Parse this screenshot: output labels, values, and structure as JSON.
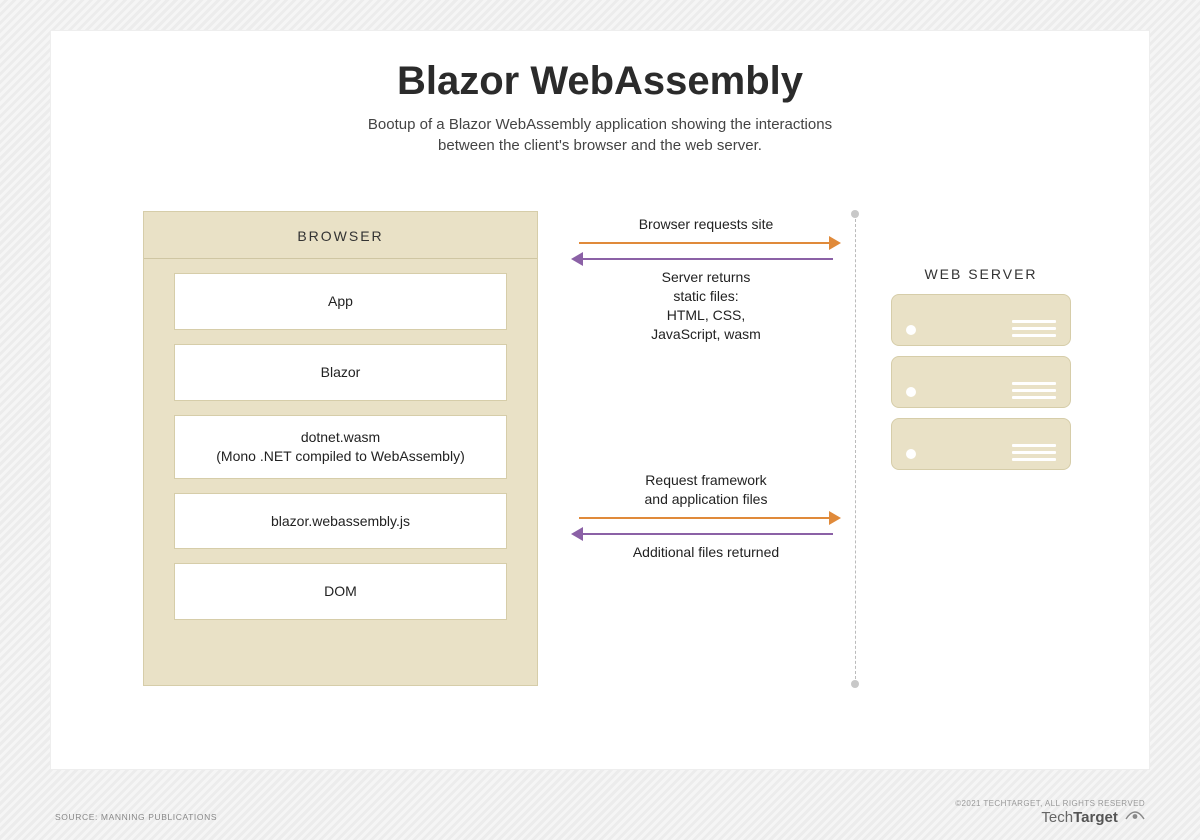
{
  "title": "Blazor WebAssembly",
  "subtitle_l1": "Bootup of a Blazor WebAssembly application showing the interactions",
  "subtitle_l2": "between the client's browser and the web server.",
  "browser": {
    "header": "BROWSER",
    "layers": {
      "app": "App",
      "blazor": "Blazor",
      "dotnet_l1": "dotnet.wasm",
      "dotnet_l2": "(Mono .NET compiled to WebAssembly)",
      "js": "blazor.webassembly.js",
      "dom": "DOM"
    }
  },
  "interactions": {
    "top_request": "Browser requests site",
    "top_response_l1": "Server returns",
    "top_response_l2": "static files:",
    "top_response_l3": "HTML, CSS,",
    "top_response_l4": "JavaScript, wasm",
    "bottom_request_l1": "Request framework",
    "bottom_request_l2": "and application files",
    "bottom_response": "Additional files returned"
  },
  "server_label": "WEB SERVER",
  "footer": {
    "source": "SOURCE: MANNING PUBLICATIONS",
    "copyright": "©2021 TECHTARGET, ALL RIGHTS RESERVED",
    "logo_light": "Tech",
    "logo_bold": "Target"
  },
  "colors": {
    "tan_bg": "#e9e1c6",
    "tan_border": "#d6cda9",
    "orange": "#e08a3a",
    "purple": "#8b61a6"
  }
}
